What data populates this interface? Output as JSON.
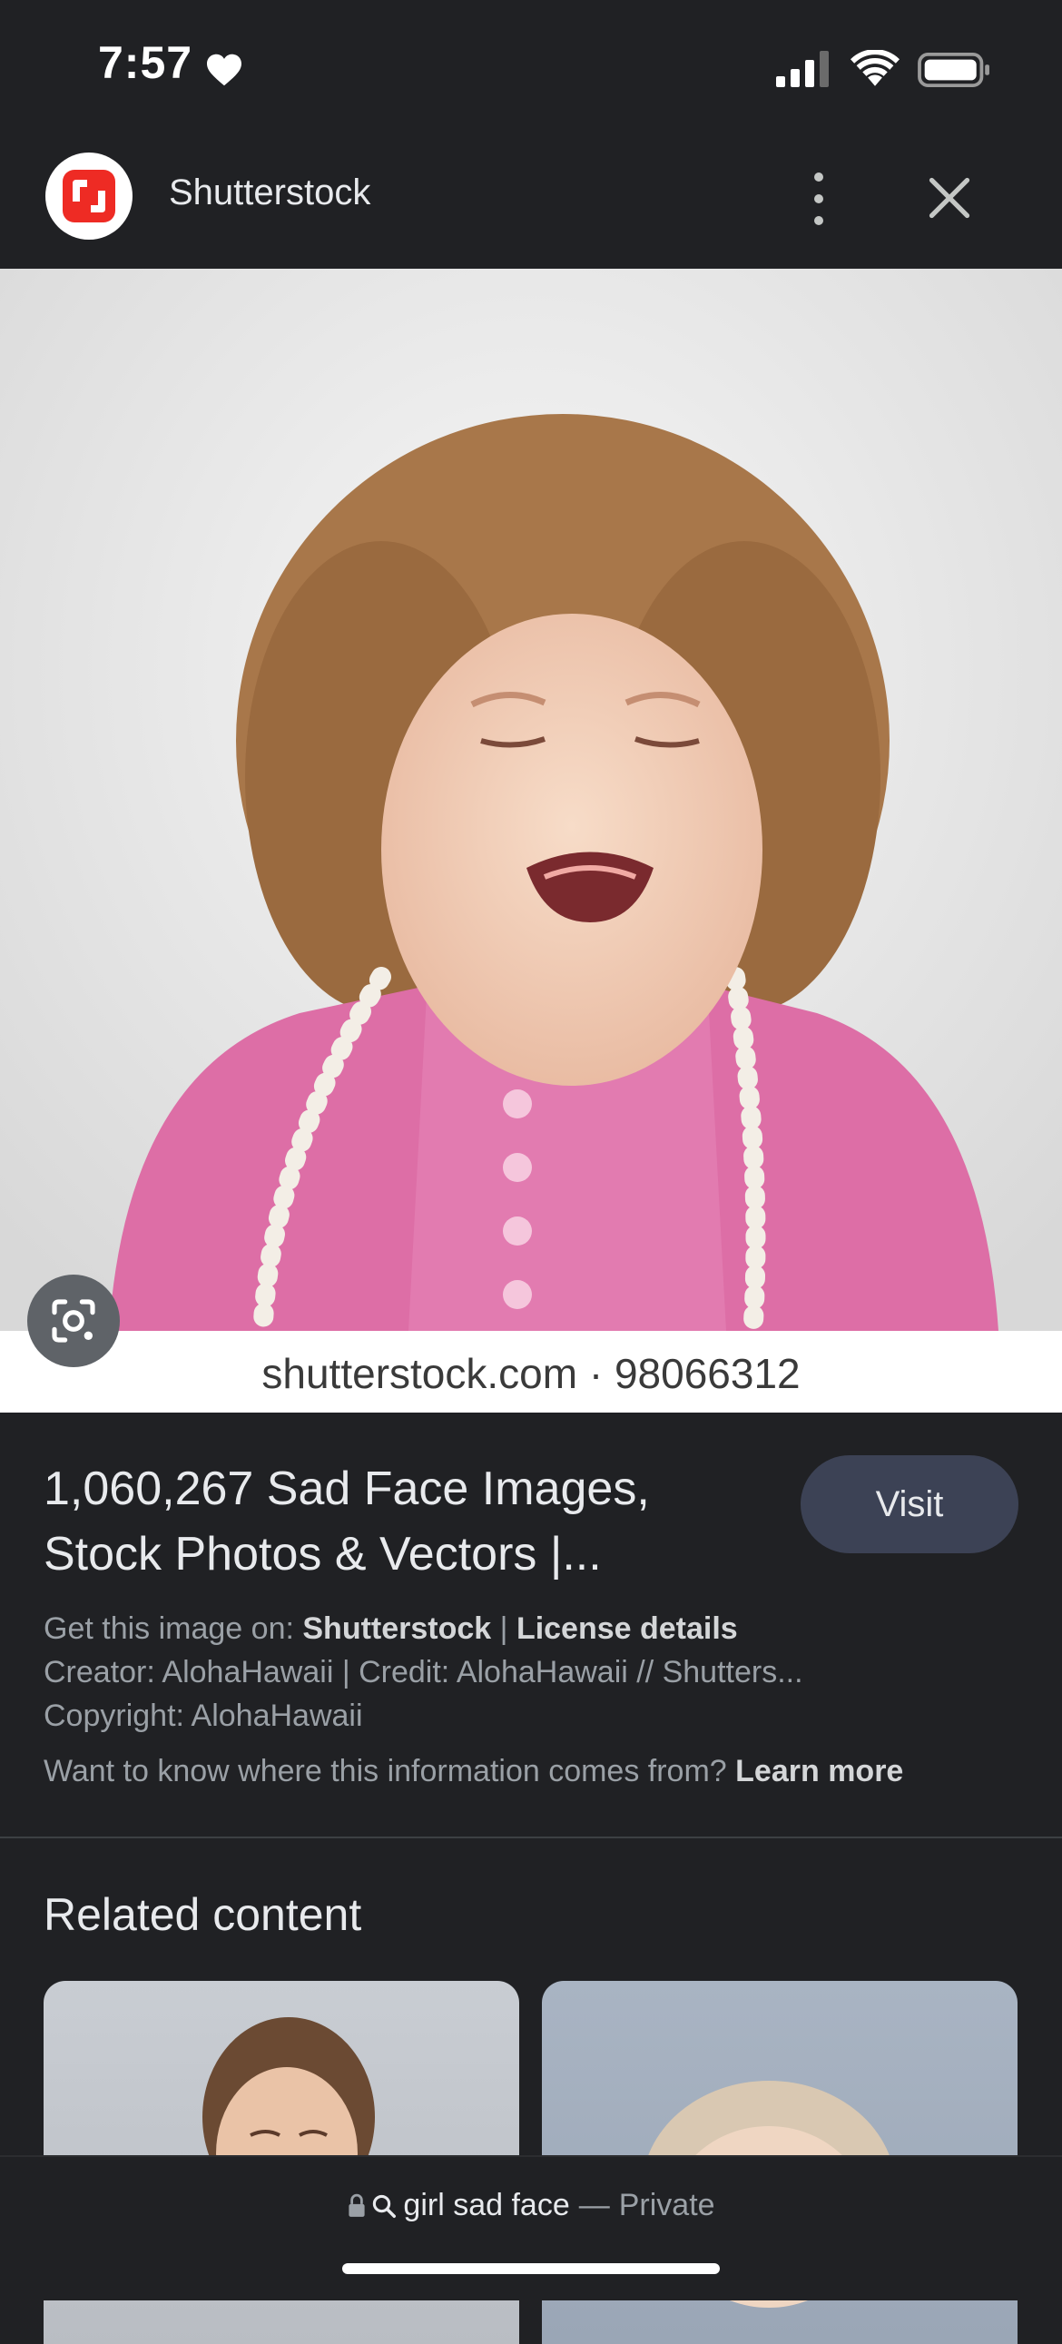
{
  "status_bar": {
    "time": "7:57",
    "icons": [
      "heart-icon",
      "cellular-signal-icon",
      "wifi-icon",
      "battery-icon"
    ]
  },
  "header": {
    "site_name": "Shutterstock",
    "logo_icon": "shutterstock-logo-icon",
    "more_icon": "more-vert-icon",
    "close_icon": "close-icon"
  },
  "image": {
    "watermark": "shutterstock.com · 98066312",
    "lens_icon": "google-lens-icon"
  },
  "result": {
    "title_line1": "1,060,267 Sad Face Images,",
    "title_line2": "Stock Photos & Vectors |...",
    "visit_label": "Visit",
    "get_image_prefix": "Get this image on: ",
    "source": "Shutterstock",
    "separator": " | ",
    "license_link": "License details",
    "creator_credit": "Creator: AlohaHawaii | Credit: AlohaHawaii // Shutters...",
    "copyright": "Copyright: AlohaHawaii",
    "info_question": "Want to know where this information comes from? ",
    "learn_more": "Learn more"
  },
  "related": {
    "heading": "Related content"
  },
  "bottom_bar": {
    "query": "girl sad face",
    "separator": "—",
    "mode": "Private"
  },
  "colors": {
    "background": "#202124",
    "visit_button": "#3c4255",
    "shutterstock_red": "#ee2b24"
  }
}
